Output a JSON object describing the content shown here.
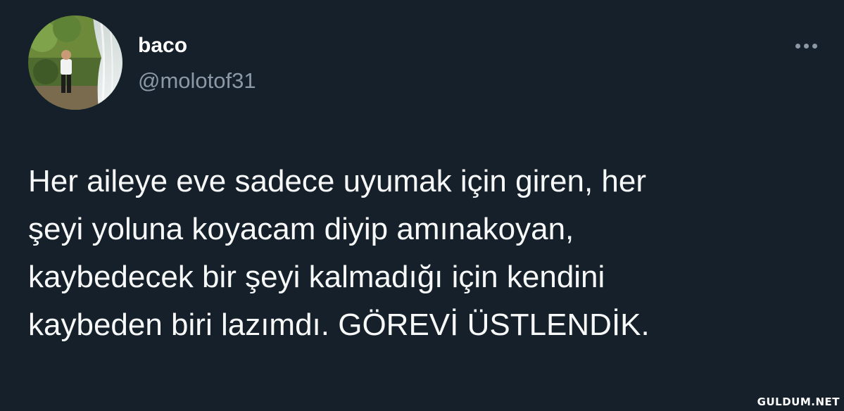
{
  "tweet": {
    "author": {
      "display_name": "baco",
      "handle": "@molotof31"
    },
    "more_icon": "ellipsis-icon",
    "text": "Her aileye eve sadece uyumak için giren, her\nşeyi yoluna koyacam diyip amınakoyan,\nkaybedecek bir şeyi kalmadığı için kendini\nkaybeden biri lazımdı. GÖREVİ ÜSTLENDİK."
  },
  "watermark": "GULDUM.NET",
  "colors": {
    "background": "#15202b",
    "text": "#f7f9f9",
    "secondary": "#8b98a5"
  }
}
